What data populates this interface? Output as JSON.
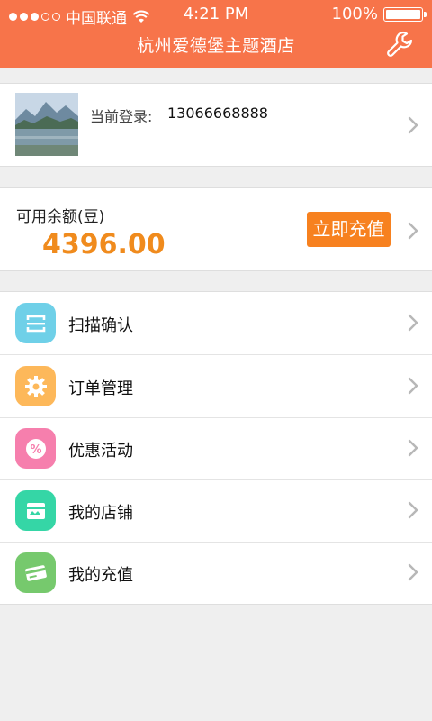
{
  "status_bar": {
    "carrier": "中国联通",
    "time": "4:21 PM",
    "battery": "100%"
  },
  "header": {
    "title": "杭州爱德堡主题酒店",
    "settings_icon": "wrench-icon"
  },
  "login": {
    "label": "当前登录:",
    "phone": "13066668888"
  },
  "balance": {
    "label": "可用余额(豆)",
    "value": "4396.00",
    "recharge_label": "立即充值"
  },
  "menu": {
    "items": [
      {
        "label": "扫描确认",
        "icon": "scan-icon",
        "color": "#6fd0e8"
      },
      {
        "label": "订单管理",
        "icon": "gear-icon",
        "color": "#fdb85a"
      },
      {
        "label": "优惠活动",
        "icon": "discount-icon",
        "color": "#f67fad"
      },
      {
        "label": "我的店铺",
        "icon": "shop-icon",
        "color": "#35d6a6"
      },
      {
        "label": "我的充值",
        "icon": "card-icon",
        "color": "#76c96d"
      }
    ]
  },
  "colors": {
    "header": "#f7744a",
    "accent_orange": "#f7811f",
    "balance_text": "#f08b1d"
  }
}
